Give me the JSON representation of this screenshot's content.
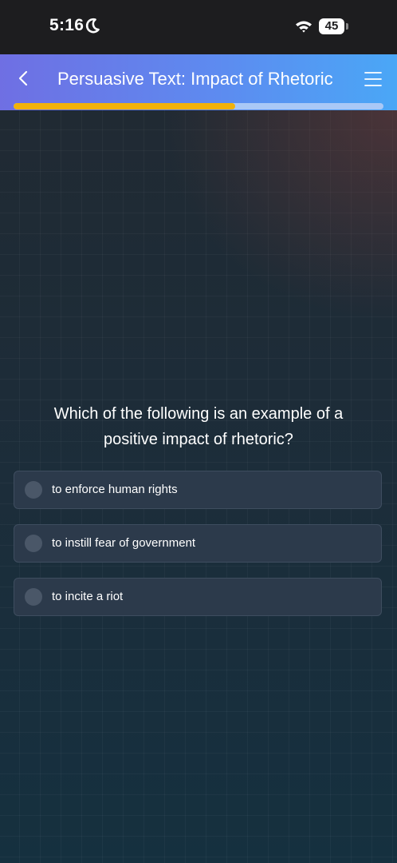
{
  "status_bar": {
    "time": "5:16",
    "battery": "45",
    "icons": [
      "moon-icon",
      "wifi-icon",
      "battery-icon"
    ]
  },
  "header": {
    "title": "Persuasive Text: Impact of Rhetoric",
    "back_icon": "chevron-left-icon",
    "menu_icon": "hamburger-menu-icon",
    "progress_fraction": 0.6
  },
  "question": {
    "text": "Which of the following is an example of a positive impact of rhetoric?"
  },
  "options": [
    {
      "label": "to enforce human rights"
    },
    {
      "label": "to instill fear of government"
    },
    {
      "label": "to incite a riot"
    }
  ],
  "colors": {
    "header_start": "#6f6fe3",
    "header_end": "#4aa7f6",
    "progress_fill": "#f2b20a",
    "progress_track": "#a9c8f6",
    "option_bg": "#2c3a4b"
  }
}
